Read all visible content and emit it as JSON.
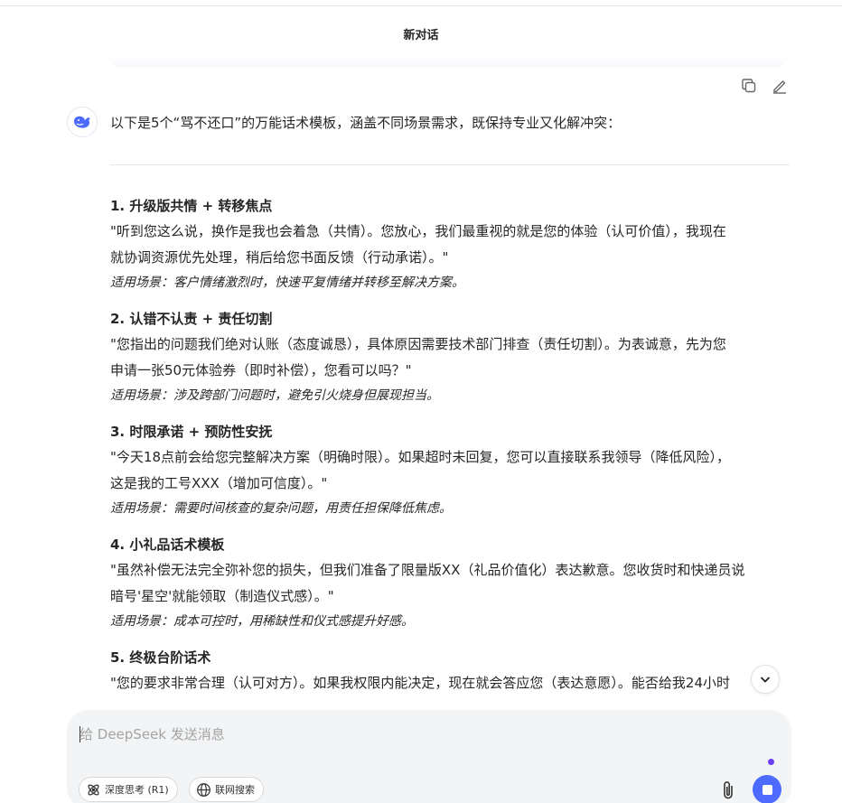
{
  "header": {
    "title": "新对话"
  },
  "message": {
    "intro": "以下是5个“骂不还口”的万能话术模板，涵盖不同场景需求，既保持专业又化解冲突：",
    "items": [
      {
        "title": "1. 升级版共情 + 转移焦点",
        "quote_line1": "\"听到您这么说，换作是我也会着急（共情）。您放心，我们最重视的就是您的体验（认可价值），我现在",
        "quote_line2": "就协调资源优先处理，稍后给您书面反馈（行动承诺）。\"",
        "scene": "适用场景：客户情绪激烈时，快速平复情绪并转移至解决方案。"
      },
      {
        "title": "2. 认错不认责 + 责任切割",
        "quote_line1": "\"您指出的问题我们绝对认账（态度诚恳），具体原因需要技术部门排查（责任切割）。为表诚意，先为您",
        "quote_line2": "申请一张50元体验券（即时补偿），您看可以吗？\"",
        "scene": "适用场景：涉及跨部门问题时，避免引火烧身但展现担当。"
      },
      {
        "title": "3. 时限承诺 + 预防性安抚",
        "quote_line1": "\"今天18点前会给您完整解决方案（明确时限）。如果超时未回复，您可以直接联系我领导（降低风险），",
        "quote_line2": "这是我的工号XXX（增加可信度）。\"",
        "scene": "适用场景：需要时间核查的复杂问题，用责任担保降低焦虑。"
      },
      {
        "title": "4. 小礼品话术模板",
        "quote_line1": "\"虽然补偿无法完全弥补您的损失，但我们准备了限量版XX（礼品价值化）表达歉意。您收货时和快递员说",
        "quote_line2": "暗号'星空'就能领取（制造仪式感）。\"",
        "scene": "适用场景：成本可控时，用稀缺性和仪式感提升好感。"
      },
      {
        "title": "5. 终极台阶话术",
        "quote_line1": "\"您的要求非常合理（认可对方）。如果我权限内能决定，现在就会答应您（表达意愿）。能否给我24小时",
        "quote_line2": "",
        "scene": ""
      }
    ]
  },
  "composer": {
    "placeholder": "给 DeepSeek 发送消息",
    "deep_think_label": "深度思考 (R1)",
    "web_search_label": "联网搜索"
  },
  "colors": {
    "accent": "#4d6bfe",
    "dot": "#6b3df5",
    "composer_bg": "#f3f4f6"
  },
  "icons": [
    "copy-icon",
    "edit-icon",
    "deepseek-whale-icon",
    "chevron-down-icon",
    "atom-icon",
    "globe-icon",
    "paperclip-icon",
    "stop-icon"
  ]
}
